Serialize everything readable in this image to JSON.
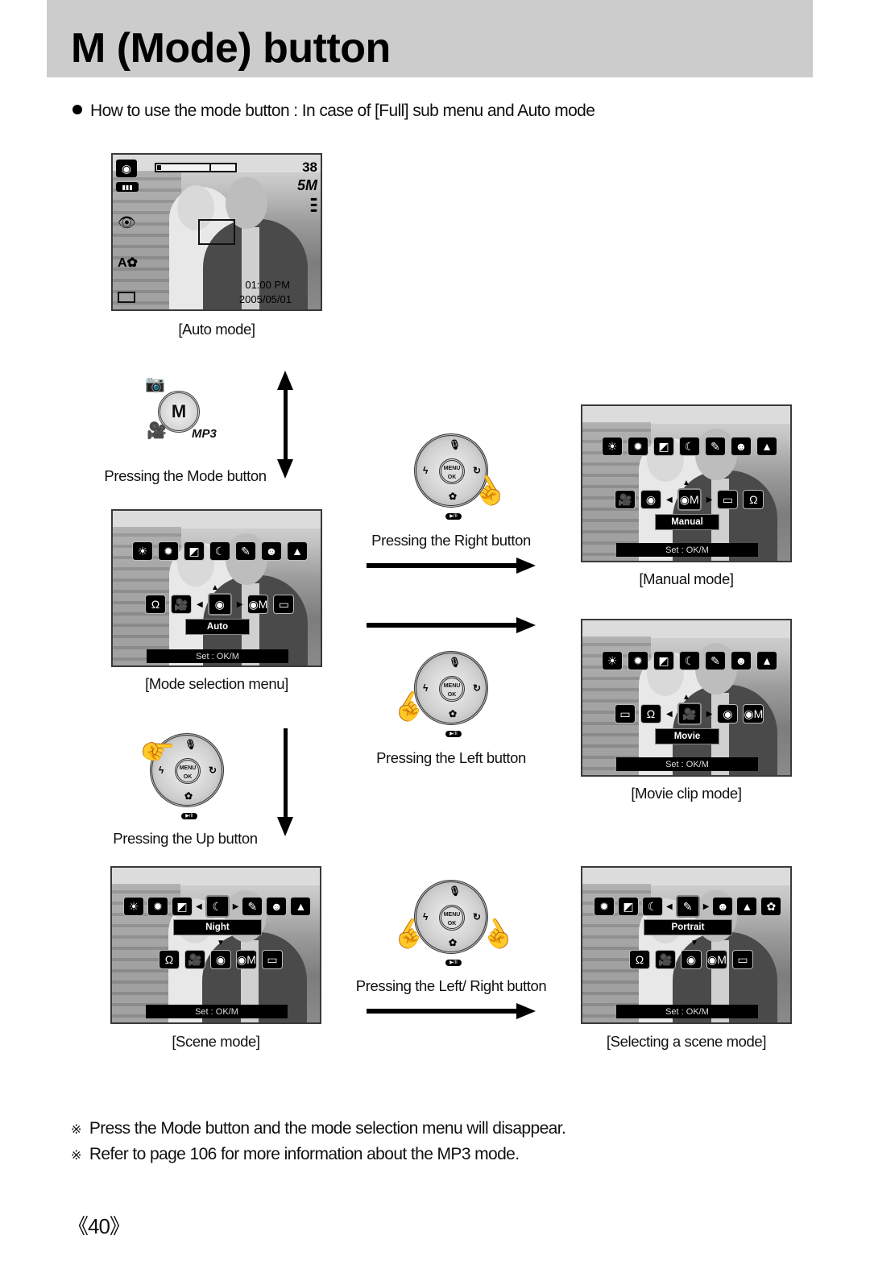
{
  "header": {
    "title": "M (Mode) button"
  },
  "intro": {
    "text": "How to use the mode button : In case of [Full] sub menu and Auto mode"
  },
  "auto_screen": {
    "shots_remaining": "38",
    "resolution": "5M",
    "time": "01:00 PM",
    "date": "2005/05/01",
    "zoom_level": 0.05,
    "icons": [
      "camera-icon",
      "battery-icon",
      "red-eye-icon",
      "auto-macro-icon",
      "card-icon",
      "quality-icon"
    ]
  },
  "captions": {
    "auto_mode": "[Auto mode]",
    "pressing_mode": "Pressing the Mode button",
    "mode_selection_menu": "[Mode selection menu]",
    "pressing_right": "Pressing the Right button",
    "manual_mode": "[Manual mode]",
    "pressing_left": "Pressing the Left button",
    "movie_clip_mode": "[Movie clip mode]",
    "pressing_up": "Pressing the Up button",
    "pressing_left_right": "Pressing the Left/ Right button",
    "scene_mode": "[Scene mode]",
    "selecting_scene_mode": "[Selecting a scene mode]"
  },
  "mode_dial": {
    "center": "M",
    "mp3": "MP3"
  },
  "dpad": {
    "center_top": "MENU",
    "center_bottom": "OK",
    "up": "🎙",
    "left": "ϟ",
    "right": "↻",
    "down": "✿",
    "play": "▶/II"
  },
  "screens": {
    "mode_selection": {
      "scene_row": [
        "☀",
        "✹",
        "◩",
        "☾",
        "✎",
        "☻",
        "▲"
      ],
      "mode_row": [
        "Ω",
        "🎥",
        "◉",
        "◉M",
        "▭"
      ],
      "selected_index": 2,
      "label": "Auto",
      "set_text": "Set : OK/M"
    },
    "manual": {
      "scene_row": [
        "☀",
        "✹",
        "◩",
        "☾",
        "✎",
        "☻",
        "▲"
      ],
      "mode_row": [
        "🎥",
        "◉",
        "◉M",
        "▭",
        "Ω"
      ],
      "selected_index": 2,
      "label": "Manual",
      "set_text": "Set : OK/M"
    },
    "movie": {
      "scene_row": [
        "☀",
        "✹",
        "◩",
        "☾",
        "✎",
        "☻",
        "▲"
      ],
      "mode_row": [
        "▭",
        "Ω",
        "🎥",
        "◉",
        "◉M"
      ],
      "selected_index": 2,
      "label": "Movie",
      "set_text": "Set : OK/M"
    },
    "scene": {
      "scene_row": [
        "☀",
        "✹",
        "◩",
        "☾",
        "✎",
        "☻",
        "▲"
      ],
      "selected_scene_index": 3,
      "mode_row": [
        "Ω",
        "🎥",
        "◉",
        "◉M",
        "▭"
      ],
      "label": "Night",
      "set_text": "Set : OK/M"
    },
    "selecting_scene": {
      "scene_row": [
        "✹",
        "◩",
        "☾",
        "✎",
        "☻",
        "▲",
        "✿"
      ],
      "selected_scene_index": 3,
      "mode_row": [
        "Ω",
        "🎥",
        "◉",
        "◉M",
        "▭"
      ],
      "label": "Portrait",
      "set_text": "Set : OK/M"
    }
  },
  "notes": [
    {
      "mark": "※",
      "text": "Press the Mode button and the mode selection menu will disappear."
    },
    {
      "mark": "※",
      "text": "Refer to page 106 for more information about the MP3 mode."
    }
  ],
  "page_number": "《40》"
}
